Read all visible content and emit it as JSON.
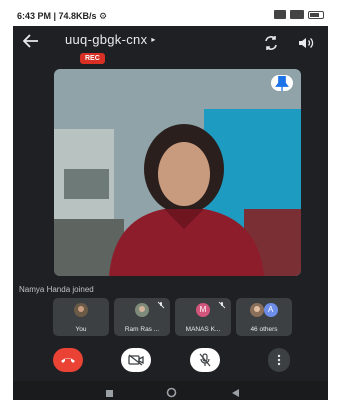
{
  "status_bar": {
    "left_text": "6:43 PM | 74.8KB/s ⚙"
  },
  "header": {
    "meeting_code": "uuq-gbgk-cnx",
    "caret": "▸",
    "rec_label": "REC"
  },
  "notification": "Namya Handa joined",
  "participants": [
    {
      "label": "You"
    },
    {
      "label": "Ram Ras ..."
    },
    {
      "label": "MANAS K...",
      "initial": "M"
    },
    {
      "label": "46 others",
      "initial": "A"
    }
  ],
  "colors": {
    "background": "#1f2023",
    "end_call": "#ea4335",
    "rec_badge": "#d93025",
    "tile": "#3c4043"
  },
  "icons": {
    "back": "arrow-left-icon",
    "switch_camera": "switch-camera-icon",
    "speaker": "speaker-icon",
    "pin": "pin-icon",
    "end_call": "phone-hangup-icon",
    "camera_off": "camera-off-icon",
    "mic_off": "mic-off-icon",
    "more": "more-vertical-icon"
  }
}
